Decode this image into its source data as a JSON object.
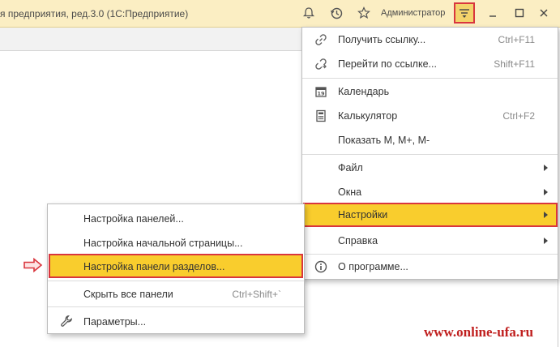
{
  "titlebar": {
    "title": "я предприятия, ред.3.0  (1С:Предприятие)",
    "user": "Администратор",
    "icons": [
      "bell-icon",
      "history-icon",
      "star-icon",
      "main-menu-icon",
      "minimize-icon",
      "maximize-icon",
      "close-icon"
    ]
  },
  "main_menu": {
    "items": [
      {
        "label": "Получить ссылку...",
        "shortcut": "Ctrl+F11",
        "icon": "link-icon"
      },
      {
        "label": "Перейти по ссылке...",
        "shortcut": "Shift+F11",
        "icon": "goto-link-icon"
      },
      {
        "label": "Календарь",
        "shortcut": "",
        "icon": "calendar-icon",
        "icon_text": "19"
      },
      {
        "label": "Калькулятор",
        "shortcut": "Ctrl+F2",
        "icon": "calculator-icon"
      },
      {
        "label": "Показать M, M+, M-",
        "shortcut": ""
      },
      {
        "label": "Файл",
        "submenu": true
      },
      {
        "label": "Окна",
        "submenu": true
      },
      {
        "label": "Настройки",
        "submenu": true,
        "highlighted": true
      },
      {
        "label": "Справка",
        "submenu": true
      },
      {
        "label": "О программе...",
        "icon": "info-icon"
      }
    ]
  },
  "settings_submenu": {
    "items": [
      {
        "label": "Настройка панелей..."
      },
      {
        "label": "Настройка начальной страницы..."
      },
      {
        "label": "Настройка панели разделов...",
        "highlighted": true
      },
      {
        "label": "Скрыть все панели",
        "shortcut": "Ctrl+Shift+`"
      },
      {
        "label": "Параметры...",
        "icon": "wrench-icon"
      }
    ]
  },
  "watermark": "www.online-ufa.ru",
  "colors": {
    "titlebar_bg": "#fbeec3",
    "highlight_bg": "#f9cd2d",
    "highlight_border": "#d9363e",
    "watermark": "#c0201f"
  }
}
